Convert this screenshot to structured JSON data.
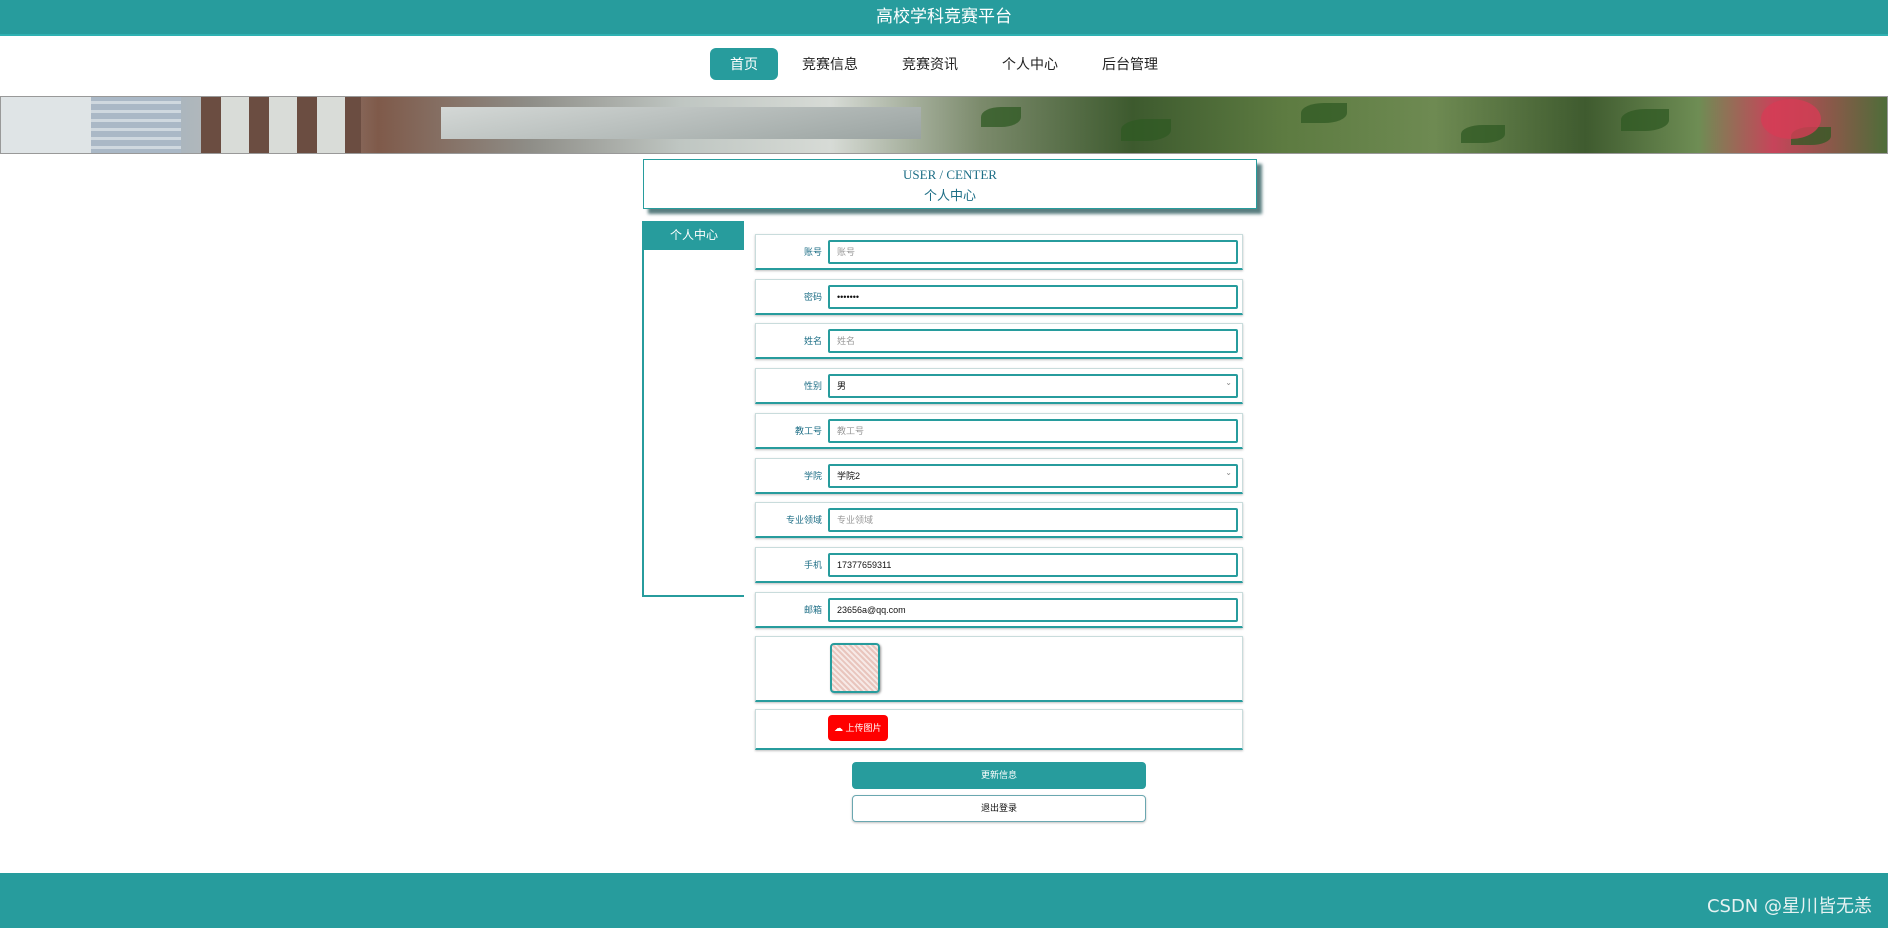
{
  "header": {
    "title": "高校学科竞赛平台"
  },
  "nav": {
    "items": [
      {
        "label": "首页"
      },
      {
        "label": "竞赛信息"
      },
      {
        "label": "竞赛资讯"
      },
      {
        "label": "个人中心"
      },
      {
        "label": "后台管理"
      }
    ]
  },
  "section_title": {
    "en": "USER / CENTER",
    "zh": "个人中心"
  },
  "sidebar": {
    "items": [
      {
        "label": "个人中心"
      }
    ]
  },
  "form": {
    "account": {
      "label": "账号",
      "placeholder": "账号",
      "value": ""
    },
    "password": {
      "label": "密码",
      "value": "•••••••"
    },
    "name": {
      "label": "姓名",
      "placeholder": "姓名",
      "value": ""
    },
    "gender": {
      "label": "性别",
      "value": "男"
    },
    "staff_no": {
      "label": "教工号",
      "placeholder": "教工号",
      "value": ""
    },
    "college": {
      "label": "学院",
      "value": "学院2"
    },
    "field": {
      "label": "专业领域",
      "placeholder": "专业领域",
      "value": ""
    },
    "phone": {
      "label": "手机",
      "value": "17377659311"
    },
    "email": {
      "label": "邮箱",
      "value": "23656a@qq.com"
    },
    "upload_label": "上传图片"
  },
  "buttons": {
    "update": "更新信息",
    "logout": "退出登录"
  },
  "watermark": "CSDN @星川皆无恙",
  "colors": {
    "accent": "#279c9d",
    "upload": "#ff0000"
  },
  "icons": {
    "upload": "cloud-upload-icon",
    "select": "chevron-down-icon"
  }
}
